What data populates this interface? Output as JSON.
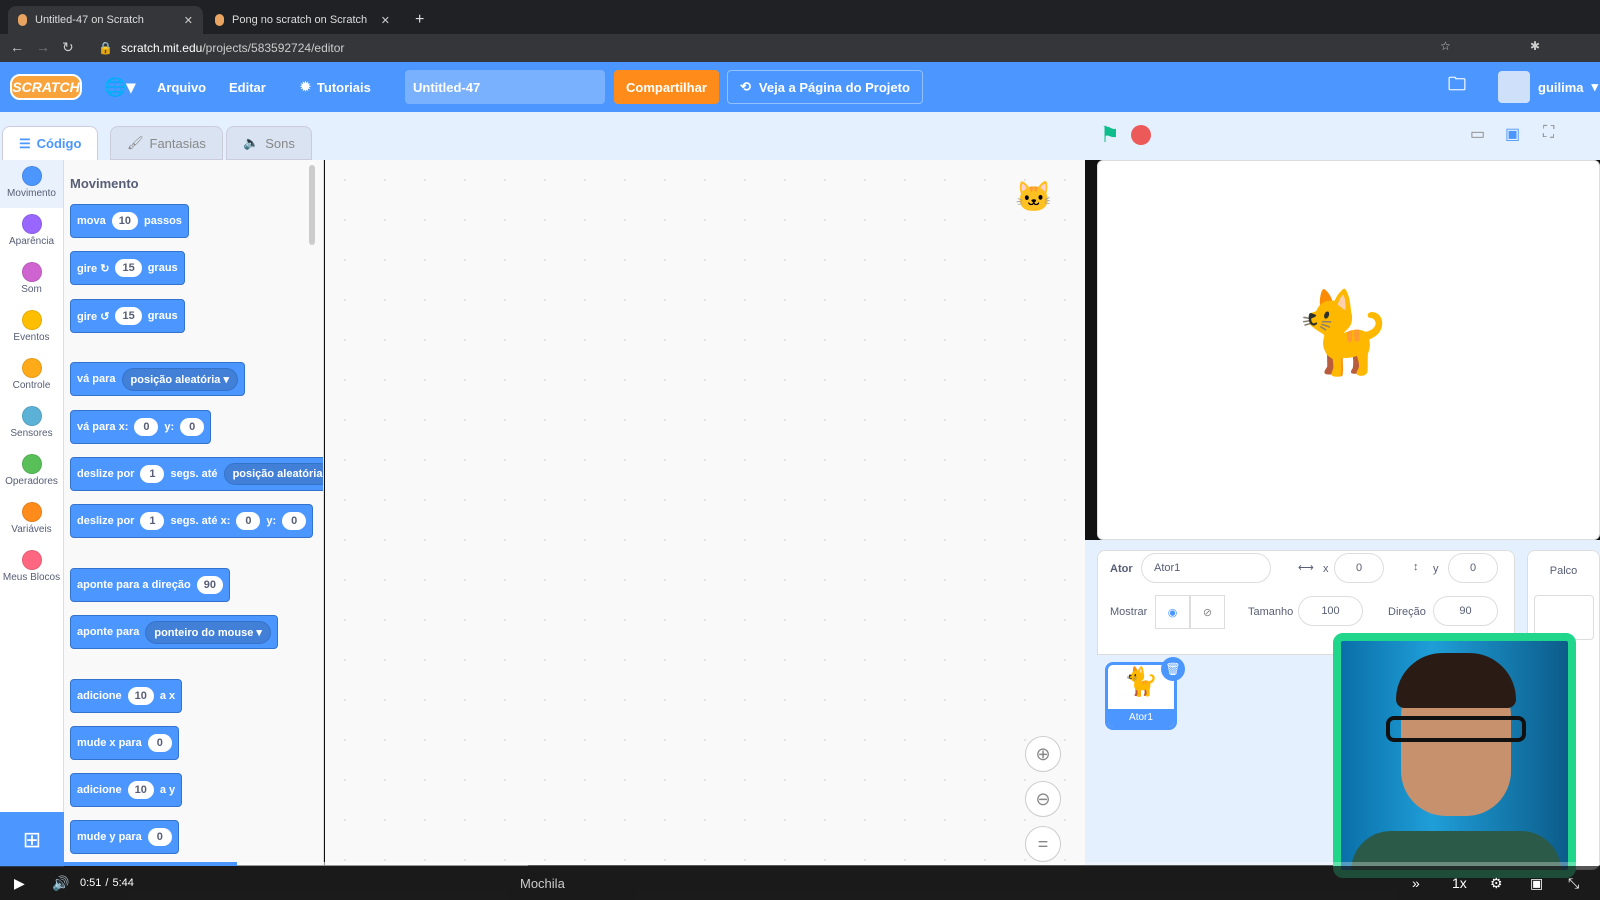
{
  "browser": {
    "tabs": [
      {
        "title": "Untitled-47 on Scratch"
      },
      {
        "title": "Pong no scratch on Scratch"
      }
    ],
    "url_host": "scratch.mit.edu",
    "url_path": "/projects/583592724/editor"
  },
  "menubar": {
    "logo": "SCRATCH",
    "file": "Arquivo",
    "edit": "Editar",
    "tutorials": "Tutoriais",
    "project_title": "Untitled-47",
    "share": "Compartilhar",
    "see_project_page": "Veja a Página do Projeto",
    "username": "guilima"
  },
  "editor_tabs": [
    {
      "label": "Código",
      "active": true
    },
    {
      "label": "Fantasias"
    },
    {
      "label": "Sons"
    }
  ],
  "categories": [
    {
      "label": "Movimento",
      "color": "#4c97ff"
    },
    {
      "label": "Aparência",
      "color": "#9966ff"
    },
    {
      "label": "Som",
      "color": "#cf63cf"
    },
    {
      "label": "Eventos",
      "color": "#ffbf00"
    },
    {
      "label": "Controle",
      "color": "#ffab19"
    },
    {
      "label": "Sensores",
      "color": "#5cb1d6"
    },
    {
      "label": "Operadores",
      "color": "#59c059"
    },
    {
      "label": "Variáveis",
      "color": "#ff8c1a"
    },
    {
      "label": "Meus Blocos",
      "color": "#ff6680"
    }
  ],
  "palette": {
    "title": "Movimento",
    "blocks": [
      {
        "parts": [
          {
            "t": "mova"
          },
          {
            "i": "10"
          },
          {
            "t": "passos"
          }
        ]
      },
      {
        "parts": [
          {
            "t": "gire ↻"
          },
          {
            "i": "15"
          },
          {
            "t": "graus"
          }
        ]
      },
      {
        "parts": [
          {
            "t": "gire ↺"
          },
          {
            "i": "15"
          },
          {
            "t": "graus"
          }
        ]
      },
      {
        "parts": [
          {
            "t": "vá para"
          },
          {
            "d": "posição aleatória ▾"
          }
        ]
      },
      {
        "parts": [
          {
            "t": "vá para x:"
          },
          {
            "i": "0"
          },
          {
            "t": "y:"
          },
          {
            "i": "0"
          }
        ]
      },
      {
        "parts": [
          {
            "t": "deslize por"
          },
          {
            "i": "1"
          },
          {
            "t": "segs. até"
          },
          {
            "d": "posição aleatória"
          }
        ]
      },
      {
        "parts": [
          {
            "t": "deslize por"
          },
          {
            "i": "1"
          },
          {
            "t": "segs. até x:"
          },
          {
            "i": "0"
          },
          {
            "t": "y:"
          },
          {
            "i": "0"
          }
        ]
      },
      {
        "parts": [
          {
            "t": "aponte para a direção"
          },
          {
            "i": "90"
          }
        ]
      },
      {
        "parts": [
          {
            "t": "aponte para"
          },
          {
            "d": "ponteiro do mouse ▾"
          }
        ]
      },
      {
        "parts": [
          {
            "t": "adicione"
          },
          {
            "i": "10"
          },
          {
            "t": "a x"
          }
        ]
      },
      {
        "parts": [
          {
            "t": "mude x para"
          },
          {
            "i": "0"
          }
        ]
      },
      {
        "parts": [
          {
            "t": "adicione"
          },
          {
            "i": "10"
          },
          {
            "t": "a y"
          }
        ]
      },
      {
        "parts": [
          {
            "t": "mude y para"
          },
          {
            "i": "0"
          }
        ]
      }
    ]
  },
  "sprite_info": {
    "sprite_label": "Ator",
    "sprite_name": "Ator1",
    "x_label": "x",
    "x": "0",
    "y_label": "y",
    "y": "0",
    "show_label": "Mostrar",
    "size_label": "Tamanho",
    "size": "100",
    "direction_label": "Direção",
    "direction": "90"
  },
  "sprites": [
    {
      "name": "Ator1",
      "selected": true
    }
  ],
  "stage_panel": {
    "label": "Palco"
  },
  "backpack": "Mochila",
  "video": {
    "current": "0:51",
    "duration": "5:44",
    "progress": 0.148,
    "speed": "1x"
  }
}
